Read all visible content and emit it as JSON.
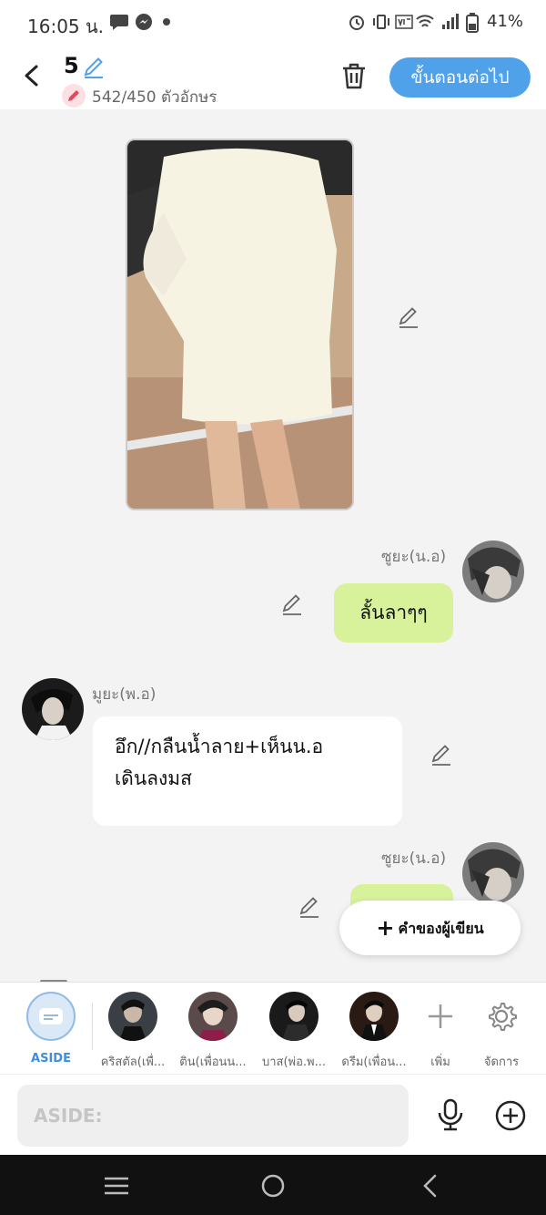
{
  "status_bar": {
    "time": "16:05 น.",
    "battery_percent": "41%"
  },
  "header": {
    "episode_number": "5",
    "char_count": "542/450 ตัวอักษร",
    "next_button_label": "ขั้นตอนต่อไป"
  },
  "messages": [
    {
      "type": "image",
      "side": "center",
      "description_icon": "image-photo"
    },
    {
      "type": "text",
      "side": "right",
      "sender": "ซูยะ(น.อ)",
      "text": "ลั้นลาๆๆ"
    },
    {
      "type": "text",
      "side": "left",
      "sender": "มูยะ(พ.อ)",
      "text_line1": "อึก//กลืนน้ำลาย+เห็นน.อ",
      "text_line2": "เดินลงมส"
    },
    {
      "type": "text",
      "side": "right",
      "sender": "ซูยะ(น.อ)",
      "text": ""
    }
  ],
  "writer_button": {
    "plus": "+",
    "label": "คำของผู้เขียน"
  },
  "character_strip": {
    "aside_label": "ASIDE",
    "characters": [
      {
        "label": "คริสตัล(เพื่..."
      },
      {
        "label": "ติน(เพื่อนน..."
      },
      {
        "label": "บาส(พ่อ.พ..."
      },
      {
        "label": "ดรีม(เพื่อน..."
      }
    ],
    "add_label": "เพิ่ม",
    "manage_label": "จัดการ"
  },
  "input": {
    "placeholder": "ASIDE:"
  },
  "colors": {
    "accent_blue": "#4fa1ea",
    "bubble_green": "#d7f29a",
    "chat_background": "#f3f3f3"
  }
}
